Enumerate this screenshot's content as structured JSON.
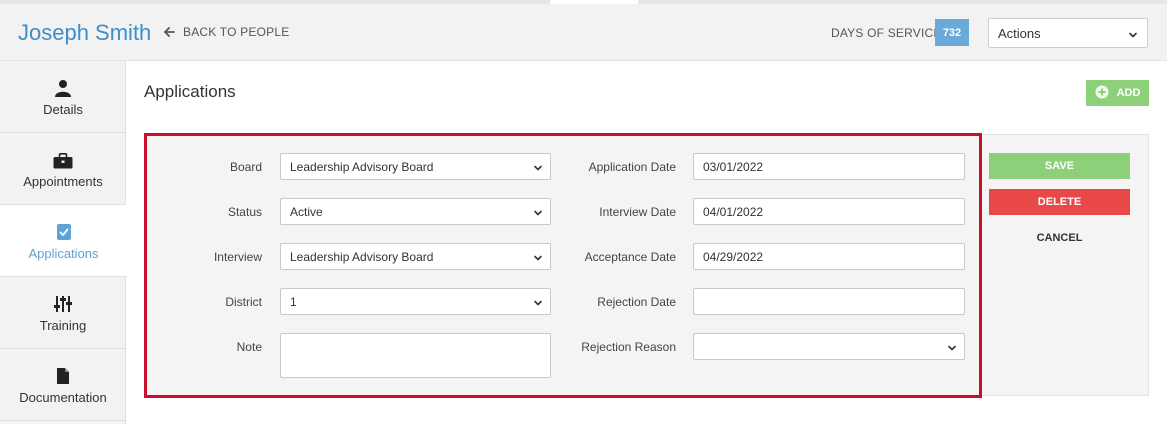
{
  "header": {
    "person_name": "Joseph Smith",
    "back_link": "BACK TO PEOPLE",
    "days_of_service_label": "DAYS OF SERVICE",
    "days_of_service_value": "732",
    "actions_select": "Actions"
  },
  "sidebar": {
    "items": [
      {
        "label": "Details",
        "icon": "person-icon"
      },
      {
        "label": "Appointments",
        "icon": "briefcase-icon"
      },
      {
        "label": "Applications",
        "icon": "checkbox-icon",
        "active": true
      },
      {
        "label": "Training",
        "icon": "sliders-icon"
      },
      {
        "label": "Documentation",
        "icon": "document-icon"
      }
    ]
  },
  "main": {
    "title": "Applications",
    "add_label": "ADD"
  },
  "form": {
    "left": {
      "board": {
        "label": "Board",
        "value": "Leadership Advisory Board"
      },
      "status": {
        "label": "Status",
        "value": "Active"
      },
      "interview": {
        "label": "Interview",
        "value": "Leadership Advisory Board"
      },
      "district": {
        "label": "District",
        "value": "1"
      },
      "note": {
        "label": "Note",
        "value": ""
      }
    },
    "right": {
      "application_date": {
        "label": "Application Date",
        "value": "03/01/2022"
      },
      "interview_date": {
        "label": "Interview Date",
        "value": "04/01/2022"
      },
      "acceptance_date": {
        "label": "Acceptance Date",
        "value": "04/29/2022"
      },
      "rejection_date": {
        "label": "Rejection Date",
        "value": ""
      },
      "rejection_reason": {
        "label": "Rejection Reason",
        "value": ""
      }
    }
  },
  "buttons": {
    "save": "SAVE",
    "delete": "DELETE",
    "cancel": "CANCEL"
  },
  "colors": {
    "accent_blue": "#3e8ec9",
    "green": "#8ed07a",
    "red": "#e84848",
    "highlight_border": "#c8102e"
  }
}
